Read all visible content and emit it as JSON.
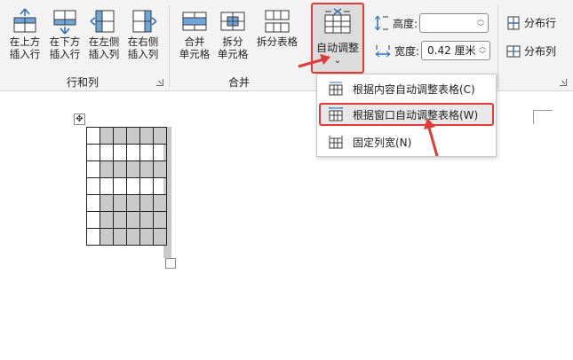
{
  "ribbon": {
    "rows_cols_group": {
      "label": "行和列",
      "buttons": [
        {
          "line1": "在上方",
          "line2": "插入行"
        },
        {
          "line1": "在下方",
          "line2": "插入行"
        },
        {
          "line1": "在左侧",
          "line2": "插入列"
        },
        {
          "line1": "在右侧",
          "line2": "插入列"
        }
      ]
    },
    "merge_group": {
      "label": "合并",
      "buttons": [
        {
          "line1": "合并",
          "line2": "单元格"
        },
        {
          "line1": "拆分",
          "line2": "单元格"
        },
        {
          "line1": "拆分表格",
          "line2": ""
        }
      ]
    },
    "autofit": {
      "label": "自动调整",
      "chevron": "⌄"
    },
    "height": {
      "label": "高度:",
      "value": ""
    },
    "width": {
      "label": "宽度:",
      "value": "0.42 厘米"
    },
    "distribute_rows": "分布行",
    "distribute_cols": "分布列"
  },
  "menu": {
    "items": [
      {
        "label": "根据内容自动调整表格(C)"
      },
      {
        "label": "根据窗口自动调整表格(W)"
      },
      {
        "label": "固定列宽(N)"
      }
    ]
  },
  "colors": {
    "accent": "#e03a3a",
    "icon_blue": "#2a6ebb"
  },
  "icons": {
    "move": "✥"
  }
}
